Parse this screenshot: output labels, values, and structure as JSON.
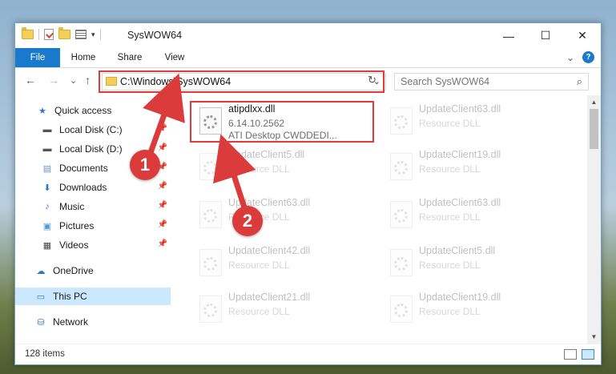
{
  "window": {
    "title": "SysWOW64",
    "controls": {
      "minimize": "—",
      "maximize": "☐",
      "close": "✕"
    }
  },
  "ribbon": {
    "tabs": [
      "File",
      "Home",
      "Share",
      "View"
    ],
    "expand_glyph": "⌄",
    "help_glyph": "?"
  },
  "nav": {
    "back": "←",
    "forward": "→",
    "recent": "⌄",
    "up": "↑",
    "address": "C:\\Windows\\SysWOW64",
    "address_dropdown": "⌄",
    "refresh": "↻",
    "search_placeholder": "Search SysWOW64"
  },
  "sidebar": {
    "items": [
      {
        "label": "Quick access",
        "icon": "star-icon",
        "glyph": "★",
        "color": "#2b77c9",
        "pinned": false
      },
      {
        "label": "Local Disk (C:)",
        "icon": "drive-icon",
        "glyph": "▬",
        "color": "#555555",
        "pinned": true
      },
      {
        "label": "Local Disk (D:)",
        "icon": "drive-icon",
        "glyph": "▬",
        "color": "#555555",
        "pinned": true
      },
      {
        "label": "Documents",
        "icon": "documents-icon",
        "glyph": "▤",
        "color": "#6f8fb8",
        "pinned": true
      },
      {
        "label": "Downloads",
        "icon": "download-icon",
        "glyph": "⬇",
        "color": "#2b77c9",
        "pinned": true
      },
      {
        "label": "Music",
        "icon": "music-icon",
        "glyph": "♪",
        "color": "#2b77c9",
        "pinned": true
      },
      {
        "label": "Pictures",
        "icon": "pictures-icon",
        "glyph": "▣",
        "color": "#4f9ad8",
        "pinned": true
      },
      {
        "label": "Videos",
        "icon": "video-icon",
        "glyph": "▦",
        "color": "#444444",
        "pinned": true
      },
      {
        "label": "OneDrive",
        "icon": "cloud-icon",
        "glyph": "☁",
        "color": "#2b77c9",
        "pinned": false
      },
      {
        "label": "This PC",
        "icon": "computer-icon",
        "glyph": "▭",
        "color": "#2b77c9",
        "pinned": false
      },
      {
        "label": "Network",
        "icon": "network-icon",
        "glyph": "⛁",
        "color": "#2b77c9",
        "pinned": false
      }
    ],
    "pin_glyph": "📌"
  },
  "files": [
    {
      "name": "atipdlxx.dll",
      "meta1": "6.14.10.2562",
      "meta2": "ATI Desktop CWDDEDI..."
    },
    {
      "name": "UpdateClient63.dll",
      "meta1": "Resource DLL",
      "meta2": ""
    },
    {
      "name": "UpdateClient5.dll",
      "meta1": "Resource DLL",
      "meta2": ""
    },
    {
      "name": "UpdateClient19.dll",
      "meta1": "Resource DLL",
      "meta2": ""
    },
    {
      "name": "UpdateClient63.dll",
      "meta1": "Resource DLL",
      "meta2": ""
    },
    {
      "name": "UpdateClient63.dll",
      "meta1": "Resource DLL",
      "meta2": ""
    },
    {
      "name": "UpdateClient42.dll",
      "meta1": "Resource DLL",
      "meta2": ""
    },
    {
      "name": "UpdateClient5.dll",
      "meta1": "Resource DLL",
      "meta2": ""
    },
    {
      "name": "UpdateClient21.dll",
      "meta1": "Resource DLL",
      "meta2": ""
    },
    {
      "name": "UpdateClient19.dll",
      "meta1": "Resource DLL",
      "meta2": ""
    }
  ],
  "status": {
    "item_count": "128 items"
  },
  "annotations": {
    "step1": "1",
    "step2": "2",
    "color": "#dc3b3b"
  }
}
